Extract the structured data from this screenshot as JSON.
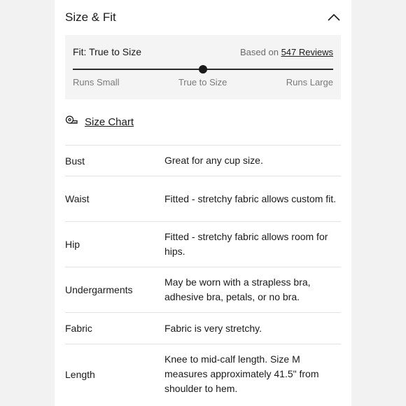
{
  "section": {
    "title": "Size & Fit"
  },
  "fit": {
    "label": "Fit: True to Size",
    "based_on_prefix": "Based on ",
    "reviews_link": "547 Reviews",
    "scale": [
      "Runs Small",
      "True to Size",
      "Runs Large"
    ],
    "position_fraction": 0.5
  },
  "size_chart": {
    "label": "Size Chart"
  },
  "details": [
    {
      "key": "Bust",
      "value": "Great for any cup size."
    },
    {
      "key": "Waist",
      "value": "Fitted - stretchy fabric allows custom fit."
    },
    {
      "key": "Hip",
      "value": "Fitted - stretchy fabric allows room for hips."
    },
    {
      "key": "Undergarments",
      "value": "May be worn with a strapless bra, adhesive bra, petals, or no bra."
    },
    {
      "key": "Fabric",
      "value": "Fabric is very stretchy."
    },
    {
      "key": "Length",
      "value": "Knee to mid-calf length. Size M measures approximately 41.5\" from shoulder to hem."
    }
  ]
}
